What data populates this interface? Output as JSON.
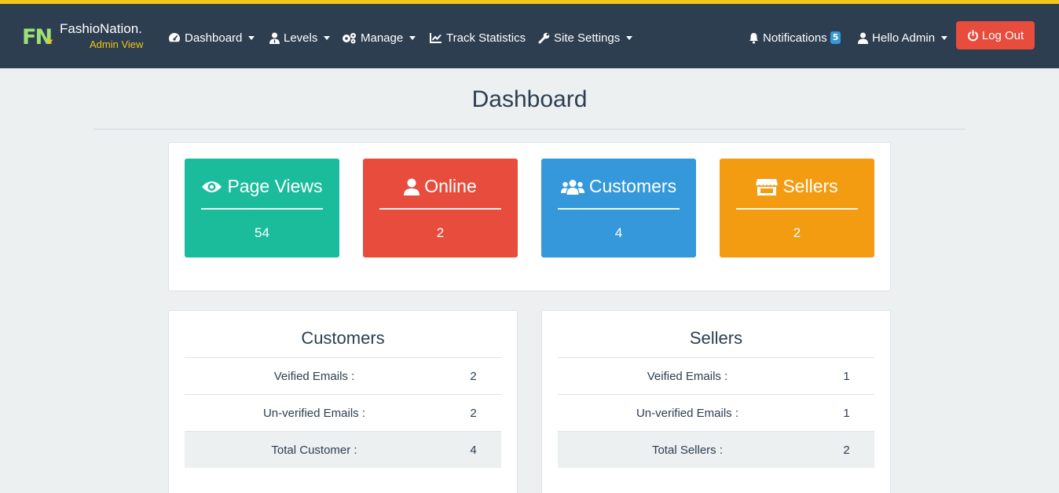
{
  "brand": {
    "logo": "FN",
    "name": "FashioNation.",
    "subtitle": "Admin View"
  },
  "nav": {
    "dashboard": "Dashboard",
    "levels": "Levels",
    "manage": "Manage",
    "track_statistics": "Track Statistics",
    "site_settings": "Site Settings",
    "notifications": "Notifications",
    "notifications_count": "5",
    "user": "Hello Admin",
    "logout": "Log Out"
  },
  "page": {
    "title": "Dashboard"
  },
  "stats": [
    {
      "label": "Page Views",
      "value": "54",
      "color": "#1abc9c",
      "icon": "eye-icon"
    },
    {
      "label": "Online",
      "value": "2",
      "color": "#e74c3c",
      "icon": "user-icon"
    },
    {
      "label": "Customers",
      "value": "4",
      "color": "#3498db",
      "icon": "users-icon"
    },
    {
      "label": "Sellers",
      "value": "2",
      "color": "#f39c12",
      "icon": "store-icon"
    }
  ],
  "customers": {
    "title": "Customers",
    "rows": [
      {
        "label": "Veified Emails :",
        "value": "2"
      },
      {
        "label": "Un-verified Emails :",
        "value": "2"
      },
      {
        "label": "Total Customer :",
        "value": "4"
      }
    ]
  },
  "sellers": {
    "title": "Sellers",
    "rows": [
      {
        "label": "Veified Emails :",
        "value": "1"
      },
      {
        "label": "Un-verified Emails :",
        "value": "1"
      },
      {
        "label": "Total Sellers :",
        "value": "2"
      }
    ]
  }
}
